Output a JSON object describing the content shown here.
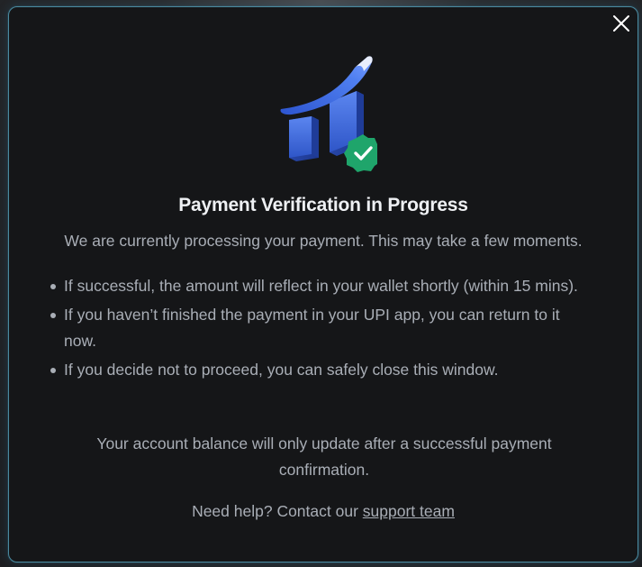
{
  "modal": {
    "close_icon": "close-icon",
    "hero_icon": "growth-chart-with-check-badge-icon",
    "title": "Payment Verification in Progress",
    "subtitle": "We are currently processing your payment. This may take a few moments.",
    "bullets": [
      "If successful, the amount will reflect in your wallet shortly (within 15 mins).",
      "If you haven’t finished the payment in your UPI app, you can return to it now.",
      "If you decide not to proceed, you can safely close this window."
    ],
    "balance_note": "Your account balance will only update after a successful payment confirmation.",
    "help_prefix": "Need help? Contact our ",
    "help_link": "support team"
  },
  "colors": {
    "accent_blue": "#3d6ee0",
    "badge_green": "#1fa56b",
    "border": "#4a8aa0"
  }
}
